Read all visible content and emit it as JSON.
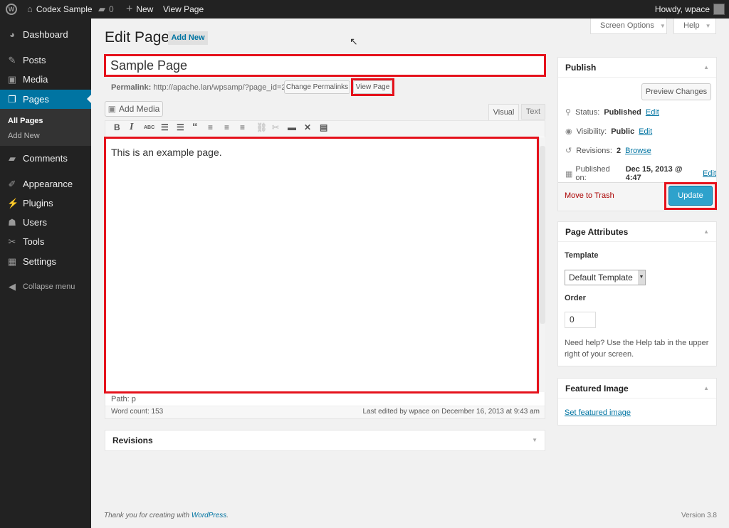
{
  "adminbar": {
    "site": "Codex Sample",
    "comments": "0",
    "new": "New",
    "view": "View Page",
    "howdy": "Howdy, wpace"
  },
  "sidebar": {
    "items": [
      {
        "label": "Dashboard",
        "icon": "dashboard-icon"
      },
      {
        "label": "Posts",
        "icon": "pin-icon"
      },
      {
        "label": "Media",
        "icon": "media-icon"
      },
      {
        "label": "Pages",
        "icon": "pages-icon",
        "active": true
      },
      {
        "label": "Comments",
        "icon": "comment-icon"
      },
      {
        "label": "Appearance",
        "icon": "brush-icon"
      },
      {
        "label": "Plugins",
        "icon": "plugin-icon"
      },
      {
        "label": "Users",
        "icon": "user-icon"
      },
      {
        "label": "Tools",
        "icon": "wrench-icon"
      },
      {
        "label": "Settings",
        "icon": "settings-icon"
      }
    ],
    "submenu": [
      "All Pages",
      "Add New"
    ],
    "collapse": "Collapse menu"
  },
  "header": {
    "title": "Edit Page",
    "add_new": "Add New",
    "screen_options": "Screen Options",
    "help": "Help"
  },
  "editor": {
    "title_value": "Sample Page",
    "permalink_label": "Permalink:",
    "permalink_url": "http://apache.lan/wpsamp/?page_id=2",
    "change_permalinks": "Change Permalinks",
    "view_page": "View Page",
    "add_media": "Add Media",
    "tab_visual": "Visual",
    "tab_text": "Text",
    "content": "This is an example page.",
    "path": "Path: p",
    "word_count": "Word count: 153",
    "last_edited": "Last edited by wpace on December 16, 2013 at 9:43 am"
  },
  "revisions_box": {
    "title": "Revisions"
  },
  "publish": {
    "title": "Publish",
    "preview": "Preview Changes",
    "status_label": "Status:",
    "status": "Published",
    "visibility_label": "Visibility:",
    "visibility": "Public",
    "revisions_label": "Revisions:",
    "revisions": "2",
    "browse": "Browse",
    "published_label": "Published on:",
    "published": "Dec 15, 2013 @ 4:47",
    "edit": "Edit",
    "trash": "Move to Trash",
    "update": "Update"
  },
  "page_attributes": {
    "title": "Page Attributes",
    "template_label": "Template",
    "template_value": "Default Template",
    "order_label": "Order",
    "order_value": "0",
    "help": "Need help? Use the Help tab in the upper right of your screen."
  },
  "featured": {
    "title": "Featured Image",
    "link": "Set featured image"
  },
  "footer": {
    "thanks": "Thank you for creating with ",
    "wp": "WordPress",
    "dot": ".",
    "version": "Version 3.8"
  },
  "colors": {
    "accent": "#0074a2",
    "highlight": "#e5121c",
    "adminbar": "#222222"
  }
}
